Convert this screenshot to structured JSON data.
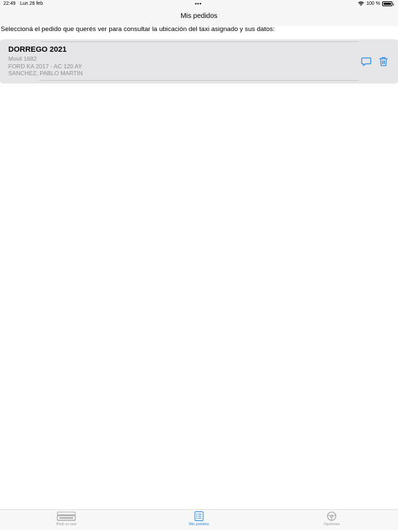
{
  "status_bar": {
    "time": "22:49",
    "date": "Lun 26 feb",
    "dots": "•••",
    "battery": "100 %"
  },
  "nav": {
    "title": "Mis pedidos"
  },
  "instruction": "Seleccioná el pedido que querés ver para consultar la ubicación del taxi asignado y sus datos:",
  "orders": [
    {
      "address": "DORREGO 2021",
      "movil": "Movil 1682",
      "vehicle": "FORD KA 2017 - AC 120 AY",
      "driver": "SANCHEZ, PABLO MARTIN"
    }
  ],
  "icons": {
    "chat": "chat-bubble-icon",
    "trash": "trash-icon",
    "tab_taxi": "taxi-sign-icon",
    "tab_orders": "list-icon",
    "tab_options": "steering-wheel-icon"
  },
  "tabs": [
    {
      "label": "Pedí un taxi",
      "active": false
    },
    {
      "label": "Mis pedidos",
      "active": true
    },
    {
      "label": "Opciones",
      "active": false
    }
  ],
  "colors": {
    "accent": "#2f8ae5",
    "card_bg": "#e6e6e8",
    "secondary_text": "#8e8e93",
    "inactive_tab": "#9a9a9a"
  }
}
